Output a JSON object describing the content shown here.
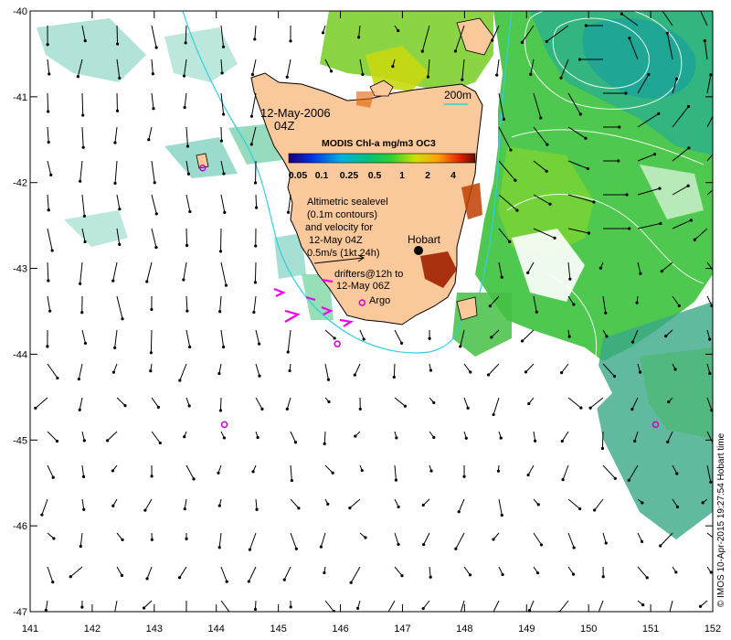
{
  "map": {
    "date_line1": "12-May-2006",
    "date_line2": "04Z",
    "contour_label": "200m",
    "colorbar_title": "MODIS Chl-a mg/m3 OC3",
    "colorbar_ticks": [
      "0.05",
      "0.1",
      "0.25",
      "0.5",
      "1",
      "2",
      "4"
    ],
    "altimetry_note": [
      "Altimetric sealevel",
      "(0.1m contours)",
      "and velocity for",
      "12-May 04Z",
      "0.5m/s (1kt 24h)"
    ],
    "drifters_note": [
      "drifters@12h to",
      "12-May 06Z"
    ],
    "argo_label": "Argo",
    "city_label": "Hobart",
    "credit": "© IMOS 10-Apr-2015 19:27:54 Hobart time",
    "lon_range": [
      141,
      152
    ],
    "lat_range": [
      -47,
      -40
    ],
    "lon_ticks": [
      "141",
      "142",
      "143",
      "144",
      "145",
      "146",
      "147",
      "148",
      "149",
      "150",
      "151",
      "152"
    ],
    "lat_ticks": [
      "-40",
      "-41",
      "-42",
      "-43",
      "-44",
      "-45",
      "-46",
      "-47"
    ],
    "colors": {
      "land": "#f9c89b",
      "chl_low": "#00a0a0",
      "chl_mid": "#3cc23c",
      "chl_high": "#d4d400",
      "contour": "#30d0e0",
      "drifter": "#ee00ee",
      "argo": "#cc00cc",
      "arrow": "#000000"
    },
    "argo_floats": [
      {
        "lon": 143.78,
        "lat": -41.83
      },
      {
        "lon": 146.35,
        "lat": -43.4
      },
      {
        "lon": 145.95,
        "lat": -43.88
      },
      {
        "lon": 144.13,
        "lat": -44.82
      },
      {
        "lon": 151.08,
        "lat": -44.82
      }
    ]
  }
}
